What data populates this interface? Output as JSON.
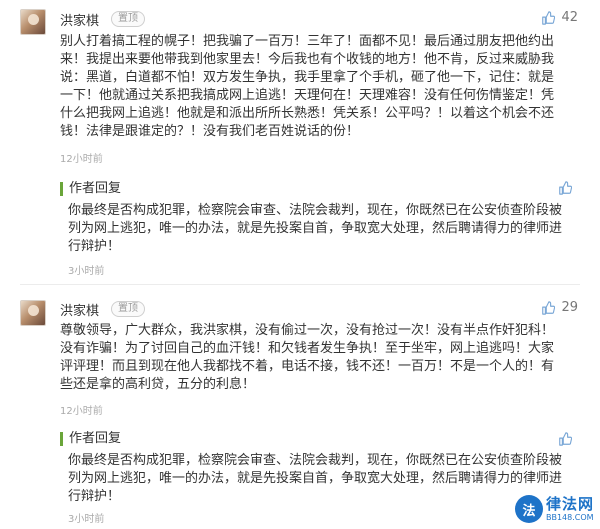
{
  "comments": [
    {
      "user": "洪家棋",
      "badge": "置顶",
      "likes": "42",
      "lines": [
        "别人打着搞工程的幌子！把我骗了一百万！三年了！面都不见！最后通过朋友把他约出",
        "来！我提出来要他带我到他家里去！今后我也有个收钱的地方！他不肯，反过来威胁我",
        "说：黑道，白道都不怕！双方发生争执，我手里拿了个手机，砸了他一下，记住：就是",
        "一下！他就通过关系把我搞成网上追逃！天理何在！天理难容！没有任何伤情鉴定！凭",
        "什么把我网上追逃！他就是和派出所所长熟悉！凭关系！公平吗？！以着这个机会不还",
        "钱！法律是跟谁定的？！没有我们老百姓说话的份！"
      ],
      "time": "12小时前",
      "reply": {
        "label": "作者回复",
        "lines": [
          "你最终是否构成犯罪，检察院会审查、法院会裁判，现在，你既然已在公安侦查阶段被",
          "列为网上逃犯，唯一的办法，就是先投案自首，争取宽大处理，然后聘请得力的律师进",
          "行辩护！"
        ],
        "time": "3小时前"
      }
    },
    {
      "user": "洪家棋",
      "badge": "置顶",
      "likes": "29",
      "lines": [
        "尊敬领导，广大群众，我洪家棋，没有偷过一次，没有抢过一次！没有半点作奸犯科！",
        "没有诈骗！为了讨回自己的血汗钱！和欠钱者发生争执！至于坐牢，网上追逃吗！大家",
        "评评理！而且到现在他人我都找不着，电话不接，钱不还！一百万！不是一个人的！有",
        "些还是拿的高利贷，五分的利息！"
      ],
      "time": "12小时前",
      "reply": {
        "label": "作者回复",
        "lines": [
          "你最终是否构成犯罪，检察院会审查、法院会裁判，现在，你既然已在公安侦查阶段被",
          "列为网上逃犯，唯一的办法，就是先投案自首，争取宽大处理，然后聘请得力的律师进",
          "行辩护！"
        ],
        "time": "3小时前"
      }
    }
  ],
  "watermark": {
    "badge": "法",
    "name": "律法网",
    "url": "BB148.COM"
  },
  "colors": {
    "reply_accent": "#6aa53a",
    "thumb_icon": "#7aa7d6",
    "watermark": "#1e73c8"
  }
}
